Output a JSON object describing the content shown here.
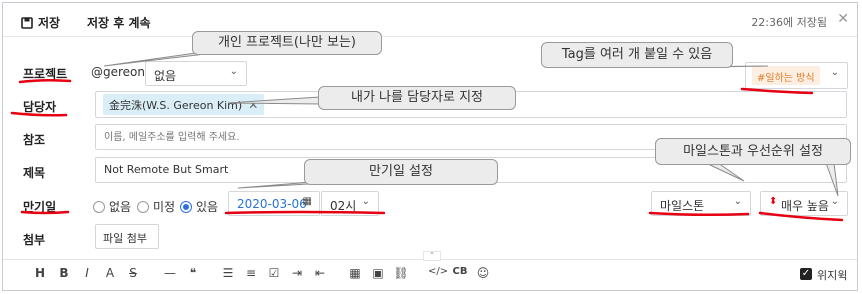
{
  "header": {
    "save_label": "저장",
    "save_continue_label": "저장 후 계속",
    "saved_at": "22:36에 저장됨"
  },
  "project": {
    "label": "프로젝트",
    "owner": "@gereon",
    "selected": "없음",
    "tag": "#일하는 방식"
  },
  "assignee": {
    "label": "담당자",
    "chip": "金完洙(W.S. Gereon Kim)"
  },
  "reference": {
    "label": "참조",
    "placeholder": "이름, 메일주소를 입력해 주세요."
  },
  "title": {
    "label": "제목",
    "value": "Not Remote But Smart"
  },
  "due": {
    "label": "만기일",
    "options": [
      "없음",
      "미정",
      "있음"
    ],
    "selected_index": 2,
    "date": "2020-03-06",
    "hour": "02시",
    "milestone": "마일스톤",
    "priority": "매우 높음"
  },
  "attach": {
    "label": "첨부",
    "button": "파일 첨부"
  },
  "toolbar": {
    "items": [
      "H",
      "B",
      "I",
      "A",
      "S",
      "—",
      "❝",
      "☰",
      "≡",
      "☑",
      "⇥",
      "⇤",
      "▦",
      "▣",
      "⛓",
      "</>",
      "CB",
      "☺"
    ],
    "wysiwyg_label": "위지윅"
  },
  "callouts": {
    "personal_project": "개인 프로젝트(나만 보는)",
    "self_assign": "내가 나를 담당자로 지정",
    "due_setting": "만기일 설정",
    "tags": "Tag를 여러 개 붙일 수 있음",
    "milestone_priority": "마일스톤과 우선순위 설정"
  },
  "colors": {
    "accent": "#2a72d8",
    "annotation_red": "#e60012",
    "tag_text": "#e07a28",
    "chip_bg": "#d9eef7"
  }
}
